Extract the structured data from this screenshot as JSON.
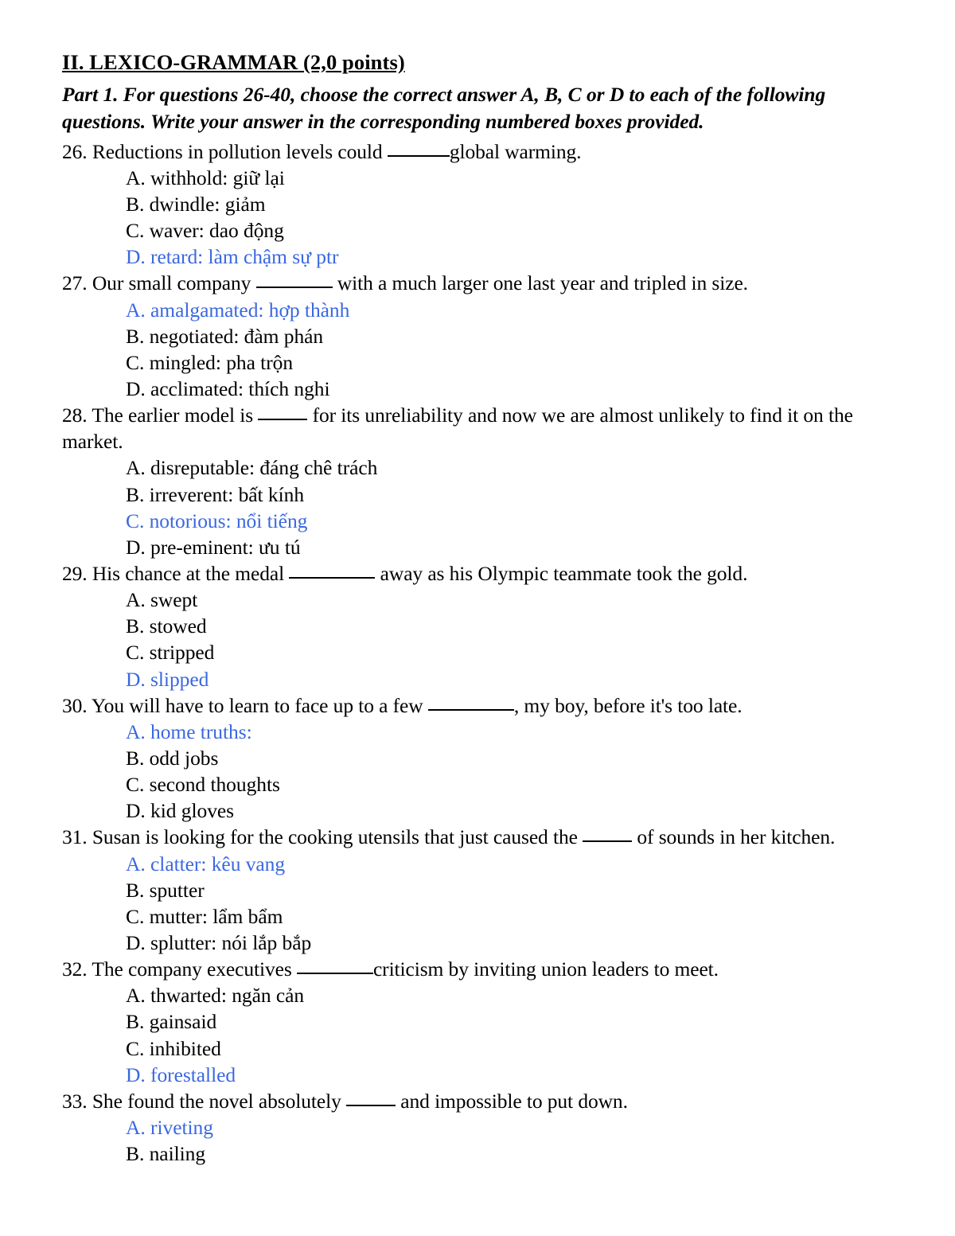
{
  "document": {
    "section_heading": "II. LEXICO-GRAMMAR (2,0 points)",
    "instructions": "Part 1. For questions 26-40, choose the correct answer A, B, C or D to each of the following questions. Write your answer in the corresponding numbered boxes provided.",
    "correct_answer_color": "#3a68e0",
    "body_text_color": "#000000",
    "page_background": "#ffffff"
  },
  "questions": [
    {
      "number": "26.",
      "text_before_blank": "Reductions in pollution levels could ",
      "blank_width": "w-md",
      "text_after_blank": "global warming.",
      "options": [
        {
          "label": "A. withhold: giữ lại",
          "correct": false
        },
        {
          "label": "B. dwindle: giảm",
          "correct": false
        },
        {
          "label": "C. waver: dao động",
          "correct": false
        },
        {
          "label": "D. retard: làm chậm sự ptr",
          "correct": true
        }
      ]
    },
    {
      "number": "27.",
      "text_before_blank": "Our small company ",
      "blank_width": "w-lg",
      "text_after_blank": " with a much larger one last year and tripled in size.",
      "options": [
        {
          "label": "A. amalgamated: hợp thành",
          "correct": true
        },
        {
          "label": "B. negotiated: đàm phán",
          "correct": false
        },
        {
          "label": "C. mingled: pha trộn",
          "correct": false
        },
        {
          "label": "D. acclimated: thích nghi",
          "correct": false
        }
      ]
    },
    {
      "number": "28.",
      "text_before_blank": "The earlier model is ",
      "blank_width": "w-sm",
      "text_after_blank": " for its unreliability and now we are almost unlikely to find it on the market.",
      "options": [
        {
          "label": "A. disreputable: đáng chê trách",
          "correct": false
        },
        {
          "label": "B. irreverent: bất kính",
          "correct": false
        },
        {
          "label": "C. notorious: nổi tiếng",
          "correct": true
        },
        {
          "label": "D. pre-eminent: ưu tú",
          "correct": false
        }
      ]
    },
    {
      "number": "29.",
      "text_before_blank": "His chance at the medal ",
      "blank_width": "w-xl",
      "text_after_blank": " away as his Olympic teammate took the gold.",
      "options": [
        {
          "label": "A. swept",
          "correct": false
        },
        {
          "label": "B. stowed",
          "correct": false
        },
        {
          "label": "C. stripped",
          "correct": false
        },
        {
          "label": "D. slipped",
          "correct": true
        }
      ]
    },
    {
      "number": "30.",
      "text_before_blank": "You will have to learn to face up to a few ",
      "blank_width": "w-xl",
      "text_after_blank": ", my boy, before it's too late.",
      "options": [
        {
          "label": "A. home truths:",
          "correct": true
        },
        {
          "label": "B. odd jobs",
          "correct": false
        },
        {
          "label": "C. second thoughts",
          "correct": false
        },
        {
          "label": "D. kid gloves",
          "correct": false
        }
      ]
    },
    {
      "number": "31.",
      "text_before_blank": "Susan is looking for the cooking utensils that just caused the ",
      "blank_width": "w-sm",
      "text_after_blank": " of sounds in her kitchen.",
      "options": [
        {
          "label": "A. clatter: kêu vang",
          "correct": true
        },
        {
          "label": "B. sputter",
          "correct": false
        },
        {
          "label": "C. mutter: lẩm bẩm",
          "correct": false
        },
        {
          "label": "D. splutter: nói lắp bắp",
          "correct": false
        }
      ]
    },
    {
      "number": "32.",
      "text_before_blank": "The company executives ",
      "blank_width": "w-lg",
      "text_after_blank": "criticism by inviting union leaders to meet.",
      "options": [
        {
          "label": "A. thwarted: ngăn cản",
          "correct": false
        },
        {
          "label": "B. gainsaid",
          "correct": false
        },
        {
          "label": "C. inhibited",
          "correct": false
        },
        {
          "label": "D. forestalled",
          "correct": true
        }
      ]
    },
    {
      "number": "33.",
      "text_before_blank": "She found the novel absolutely ",
      "blank_width": "w-sm",
      "text_after_blank": " and impossible to put down.",
      "options": [
        {
          "label": "A. riveting",
          "correct": true
        },
        {
          "label": "B. nailing",
          "correct": false
        }
      ]
    }
  ]
}
